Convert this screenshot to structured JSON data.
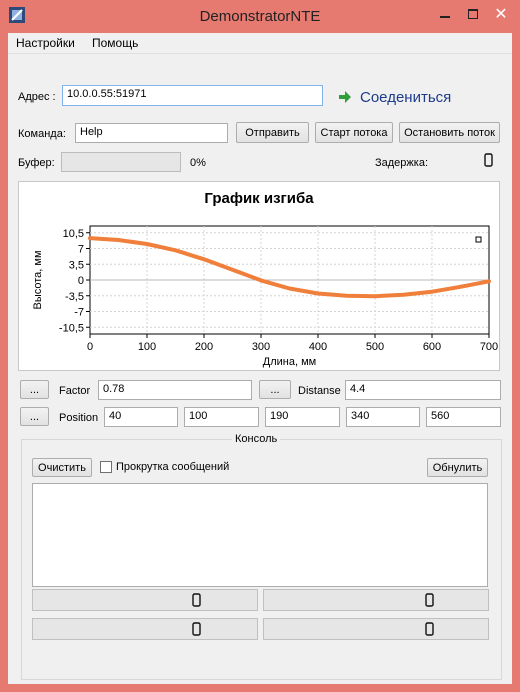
{
  "window": {
    "title": "DemonstratorNTE"
  },
  "menu": {
    "settings": "Настройки",
    "help": "Помощь"
  },
  "address": {
    "label": "Адрес :",
    "value": "10.0.0.55:51971"
  },
  "connect": {
    "label": "Соедениться"
  },
  "command": {
    "label": "Команда:",
    "value": "Help",
    "send": "Отправить",
    "start_stream": "Старт потока",
    "stop_stream": "Остановить поток"
  },
  "buffer": {
    "label": "Буфер:",
    "percent_text": "0%",
    "fill_fraction": 0
  },
  "delay": {
    "label": "Задержка:",
    "value": "0"
  },
  "chart_data": {
    "type": "line",
    "title": "График изгиба",
    "xlabel": "Длина, мм",
    "ylabel": "Высота, мм",
    "xlim": [
      0,
      700
    ],
    "ylim": [
      -12,
      12
    ],
    "x_ticks": [
      0,
      100,
      200,
      300,
      400,
      500,
      600,
      700
    ],
    "y_ticks": [
      "10,5",
      "7",
      "3,5",
      "0",
      "-3,5",
      "-7",
      "-10,5"
    ],
    "y_tick_values": [
      10.5,
      7,
      3.5,
      0,
      -3.5,
      -7,
      -10.5
    ],
    "grid": true,
    "line_color": "#ef7f3a",
    "series": [
      {
        "x": [
          0,
          50,
          100,
          150,
          200,
          250,
          300,
          350,
          400,
          450,
          500,
          550,
          600,
          650,
          700
        ],
        "y": [
          9.3,
          8.9,
          8.0,
          6.6,
          4.6,
          2.3,
          -0.1,
          -1.9,
          -3.0,
          -3.5,
          -3.6,
          -3.3,
          -2.6,
          -1.5,
          -0.3
        ]
      }
    ]
  },
  "factor": {
    "button": "...",
    "label": "Factor",
    "value": "0.78"
  },
  "distanse": {
    "button": "...",
    "label": "Distanse",
    "value": "4.4"
  },
  "position": {
    "button": "...",
    "label": "Position",
    "values": [
      "40",
      "100",
      "190",
      "340",
      "560"
    ]
  },
  "console": {
    "title": "Консоль",
    "clear": "Очистить",
    "scroll_label": "Прокрутка сообщений",
    "reset": "Обнулить",
    "counters": [
      "0",
      "0",
      "0",
      "0"
    ]
  }
}
